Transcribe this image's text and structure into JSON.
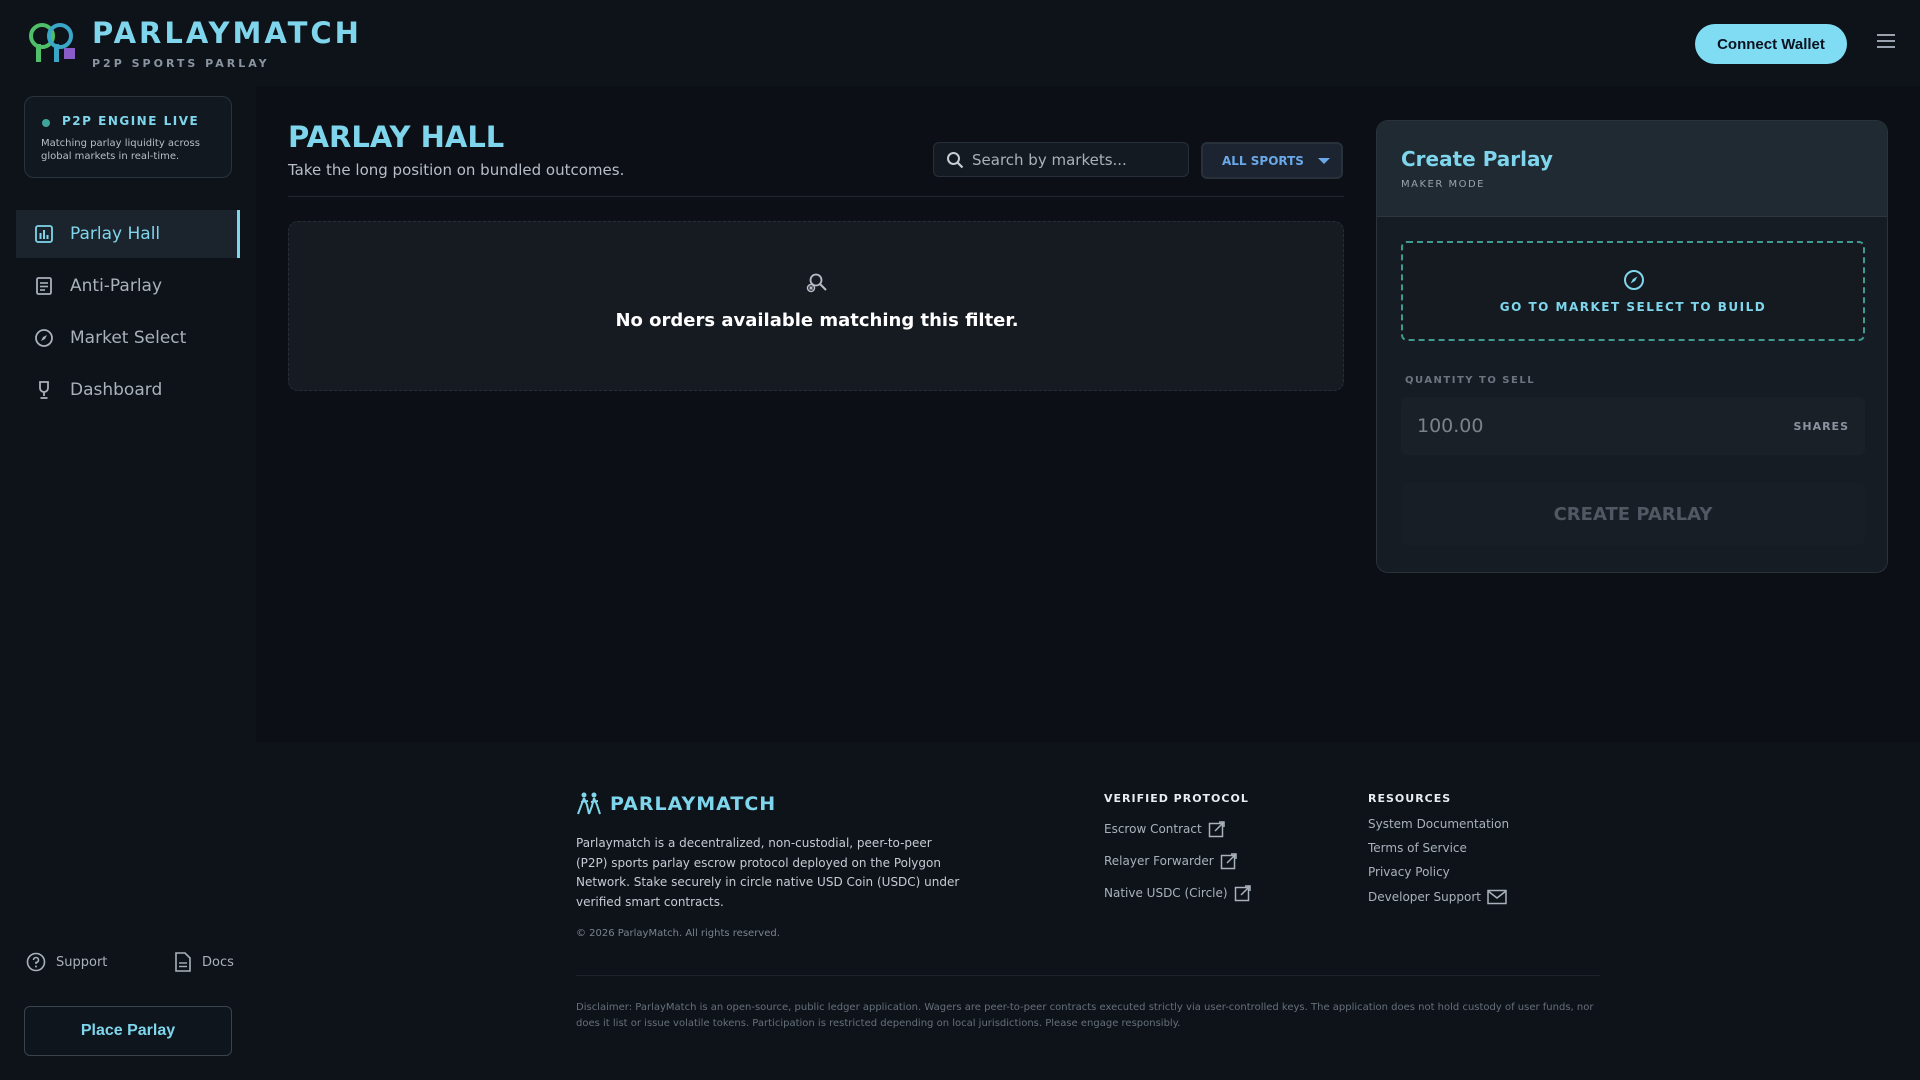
{
  "header": {
    "brand": "PARLAYMATCH",
    "tagline": "P2P SPORTS PARLAY",
    "connect_label": "Connect Wallet"
  },
  "sidebar": {
    "engine_title": "P2P ENGINE LIVE",
    "engine_desc": "Matching parlay liquidity across global markets in real-time.",
    "items": [
      {
        "label": "Parlay Hall",
        "icon": "chart-icon",
        "active": true
      },
      {
        "label": "Anti-Parlay",
        "icon": "receipt-icon",
        "active": false
      },
      {
        "label": "Market Select",
        "icon": "compass-icon",
        "active": false
      },
      {
        "label": "Dashboard",
        "icon": "trophy-icon",
        "active": false
      }
    ],
    "support_label": "Support",
    "docs_label": "Docs",
    "place_label": "Place Parlay"
  },
  "main": {
    "title": "PARLAY HALL",
    "subtitle": "Take the long position on bundled outcomes.",
    "search_placeholder": "Search by markets...",
    "sports_filter": "ALL SPORTS",
    "empty_text": "No orders available matching this filter."
  },
  "create_parlay": {
    "title": "Create Parlay",
    "mode": "MAKER MODE",
    "market_cta": "GO TO MARKET SELECT TO BUILD",
    "qty_label": "QUANTITY TO SELL",
    "qty_placeholder": "100.00",
    "qty_unit": "SHARES",
    "create_label": "CREATE PARLAY"
  },
  "footer": {
    "brand": "PARLAYMATCH",
    "description": "Parlaymatch is a decentralized, non-custodial, peer-to-peer (P2P) sports parlay escrow protocol deployed on the Polygon Network. Stake securely in circle native USD Coin (USDC) under verified smart contracts.",
    "copyright": "© 2026 ParlayMatch. All rights reserved.",
    "verified_title": "VERIFIED PROTOCOL",
    "verified_links": [
      "Escrow Contract",
      "Relayer Forwarder",
      "Native USDC (Circle)"
    ],
    "resources_title": "RESOURCES",
    "resource_links": [
      "System Documentation",
      "Terms of Service",
      "Privacy Policy",
      "Developer Support"
    ],
    "disclaimer": "Disclaimer: ParlayMatch is an open-source, public ledger application. Wagers are peer-to-peer contracts executed strictly via user-controlled keys. The application does not hold custody of user funds, nor does it list or issue volatile tokens. Participation is restricted depending on local jurisdictions. Please engage responsibly."
  },
  "colors": {
    "accent": "#7fd6ec",
    "background": "#0c1016",
    "teal": "#3f9a92"
  }
}
